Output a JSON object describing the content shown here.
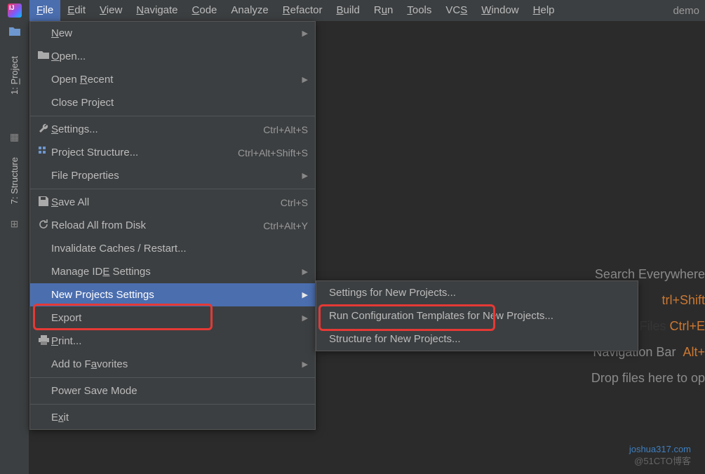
{
  "menubar": {
    "items": [
      {
        "label": "File",
        "ul": "F",
        "active": true
      },
      {
        "label": "Edit",
        "ul": "E"
      },
      {
        "label": "View",
        "ul": "V"
      },
      {
        "label": "Navigate",
        "ul": "N"
      },
      {
        "label": "Code",
        "ul": "C"
      },
      {
        "label": "Analyze",
        "ul": ""
      },
      {
        "label": "Refactor",
        "ul": "R"
      },
      {
        "label": "Build",
        "ul": "B"
      },
      {
        "label": "Run",
        "ul": "u"
      },
      {
        "label": "Tools",
        "ul": "T"
      },
      {
        "label": "VCS",
        "ul": "S"
      },
      {
        "label": "Window",
        "ul": "W"
      },
      {
        "label": "Help",
        "ul": "H"
      }
    ],
    "right": "demo"
  },
  "lefttool": {
    "project": {
      "num": "1",
      "label": "Project",
      "ul": "P"
    },
    "structure": {
      "num": "7",
      "label": "Structure"
    }
  },
  "filemenu": {
    "groups": [
      [
        {
          "label": "New",
          "ul": "N",
          "icon": "",
          "arrow": true
        },
        {
          "label": "Open...",
          "ul": "O",
          "icon": "folder"
        },
        {
          "label": "Open Recent",
          "ul": "R",
          "icon": "",
          "arrow": true
        },
        {
          "label": "Close Project",
          "ul": "",
          "icon": ""
        }
      ],
      [
        {
          "label": "Settings...",
          "ul": "S",
          "icon": "wrench",
          "shortcut": "Ctrl+Alt+S"
        },
        {
          "label": "Project Structure...",
          "ul": "",
          "icon": "structure",
          "shortcut": "Ctrl+Alt+Shift+S"
        },
        {
          "label": "File Properties",
          "ul": "",
          "icon": "",
          "arrow": true
        }
      ],
      [
        {
          "label": "Save All",
          "ul": "S",
          "icon": "save",
          "shortcut": "Ctrl+S"
        },
        {
          "label": "Reload All from Disk",
          "ul": "",
          "icon": "reload",
          "shortcut": "Ctrl+Alt+Y"
        },
        {
          "label": "Invalidate Caches / Restart...",
          "ul": "",
          "icon": ""
        },
        {
          "label": "Manage IDE Settings",
          "ul": "E",
          "icon": "",
          "arrow": true
        },
        {
          "label": "New Projects Settings",
          "ul": "",
          "icon": "",
          "arrow": true,
          "highlight": true
        },
        {
          "label": "Export",
          "ul": "",
          "icon": "",
          "arrow": true
        },
        {
          "label": "Print...",
          "ul": "P",
          "icon": "print"
        },
        {
          "label": "Add to Favorites",
          "ul": "a",
          "icon": "",
          "arrow": true
        }
      ],
      [
        {
          "label": "Power Save Mode",
          "ul": "",
          "icon": ""
        }
      ],
      [
        {
          "label": "Exit",
          "ul": "x",
          "icon": ""
        }
      ]
    ]
  },
  "submenu": [
    "Settings for New Projects...",
    "Run Configuration Templates for New Projects...",
    "Structure for New Projects..."
  ],
  "hints": {
    "l1": "Search Everywhere",
    "l2_sc": "trl+Shift",
    "l3": "",
    "l3_sc": "Ctrl+E",
    "l4": "Navigation Bar",
    "l4_sc": "Alt+",
    "l5": "Drop files here to op"
  },
  "recentfiles_prefix_hidden": "Recent Files  ",
  "watermark": "joshua317.com",
  "watermark2": "@51CTO博客"
}
